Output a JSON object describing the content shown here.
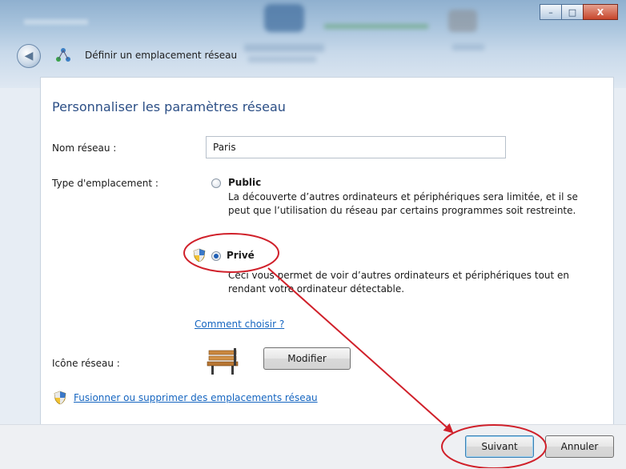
{
  "window": {
    "title": "Définir un emplacement réseau",
    "controls": {
      "minimize": "–",
      "maximize": "□",
      "close": "X"
    }
  },
  "main": {
    "heading": "Personnaliser les paramètres réseau",
    "network_name_label": "Nom réseau :",
    "network_name_value": "Paris",
    "location_type_label": "Type d'emplacement :",
    "options": [
      {
        "title": "Public",
        "desc_line1": "La découverte d’autres ordinateurs et périphériques sera limitée, et il se",
        "desc_line2": "peut que l’utilisation du réseau par certains programmes soit restreinte.",
        "selected": false
      },
      {
        "title": "Privé",
        "desc_line1": "Ceci vous permet de voir d’autres ordinateurs et périphériques tout en",
        "desc_line2": "rendant votre ordinateur détectable.",
        "selected": true
      }
    ],
    "how_to_choose_link": "Comment choisir ?",
    "network_icon_label": "Icône réseau :",
    "modify_button": "Modifier",
    "merge_link": "Fusionner ou supprimer des emplacements réseau"
  },
  "footer": {
    "next_button": "Suivant",
    "cancel_button": "Annuler"
  },
  "colors": {
    "heading": "#2c4f86",
    "link": "#1565c0",
    "annotation": "#d0202a"
  }
}
